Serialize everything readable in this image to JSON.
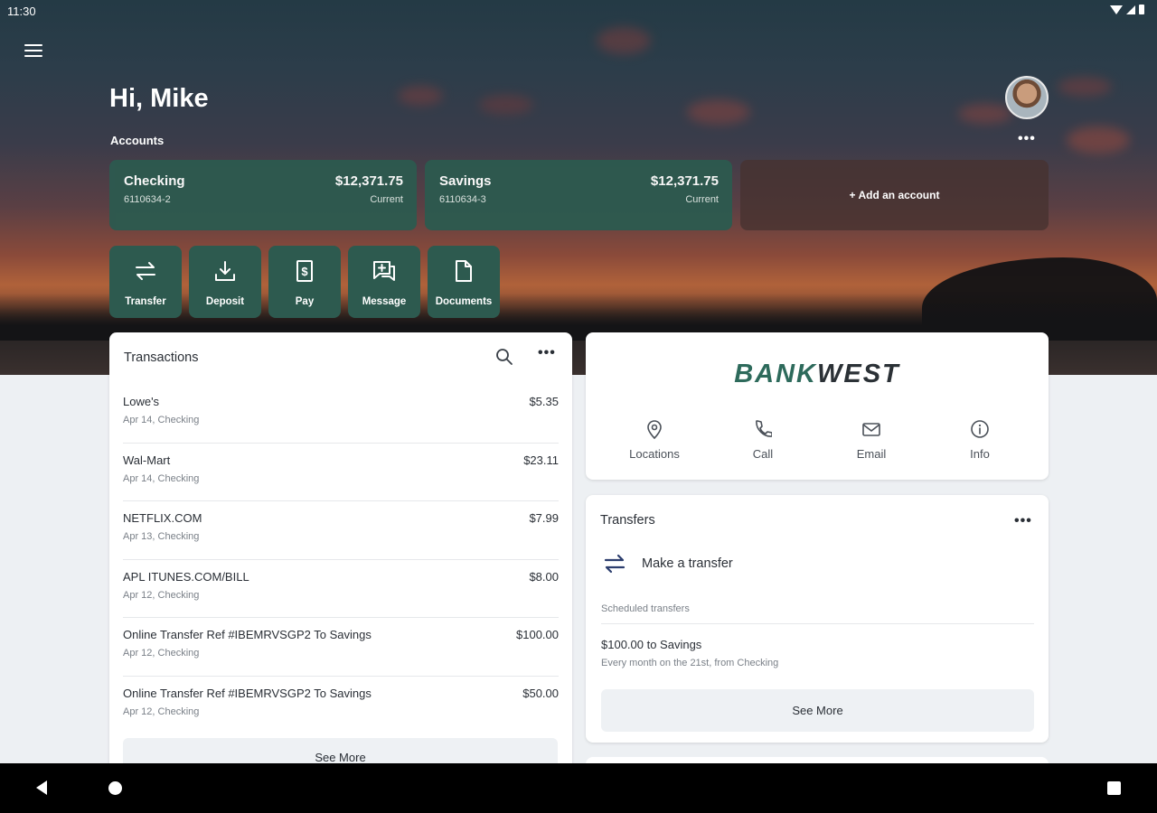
{
  "status_bar": {
    "time": "11:30"
  },
  "header": {
    "greeting": "Hi, Mike",
    "accounts_label": "Accounts",
    "more_label": "•••"
  },
  "accounts": [
    {
      "name": "Checking",
      "number": "6110634-2",
      "balance": "$12,371.75",
      "balance_label": "Current"
    },
    {
      "name": "Savings",
      "number": "6110634-3",
      "balance": "$12,371.75",
      "balance_label": "Current"
    }
  ],
  "add_account_label": "+ Add an account",
  "quick_actions": [
    {
      "label": "Transfer",
      "icon": "transfer-icon"
    },
    {
      "label": "Deposit",
      "icon": "deposit-icon"
    },
    {
      "label": "Pay",
      "icon": "pay-icon"
    },
    {
      "label": "Message",
      "icon": "message-icon"
    },
    {
      "label": "Documents",
      "icon": "document-icon"
    }
  ],
  "transactions": {
    "title": "Transactions",
    "items": [
      {
        "description": "Lowe's",
        "meta": "Apr 14, Checking",
        "amount": "$5.35"
      },
      {
        "description": "Wal-Mart",
        "meta": "Apr 14, Checking",
        "amount": "$23.11"
      },
      {
        "description": "NETFLIX.COM",
        "meta": "Apr 13, Checking",
        "amount": "$7.99"
      },
      {
        "description": "APL ITUNES.COM/BILL",
        "meta": "Apr 12, Checking",
        "amount": "$8.00"
      },
      {
        "description": "Online Transfer Ref #IBEMRVSGP2 To Savings",
        "meta": "Apr 12, Checking",
        "amount": "$100.00"
      },
      {
        "description": "Online Transfer Ref #IBEMRVSGP2 To Savings",
        "meta": "Apr 12, Checking",
        "amount": "$50.00"
      }
    ],
    "see_more": "See More"
  },
  "bank": {
    "logo_part1": "BANK",
    "logo_part2": "WEST",
    "actions": [
      {
        "label": "Locations",
        "icon": "location-pin-icon"
      },
      {
        "label": "Call",
        "icon": "phone-icon"
      },
      {
        "label": "Email",
        "icon": "email-icon"
      },
      {
        "label": "Info",
        "icon": "info-icon"
      }
    ]
  },
  "transfers": {
    "title": "Transfers",
    "make_transfer": "Make a transfer",
    "scheduled_label": "Scheduled transfers",
    "scheduled_item_title": "$100.00 to Savings",
    "scheduled_item_sub": "Every month on the 21st, from Checking",
    "see_more": "See More"
  },
  "colors": {
    "accent_green": "#2d5a4f",
    "logo_green": "#2d6a5b",
    "page_bg": "#edf0f3"
  }
}
